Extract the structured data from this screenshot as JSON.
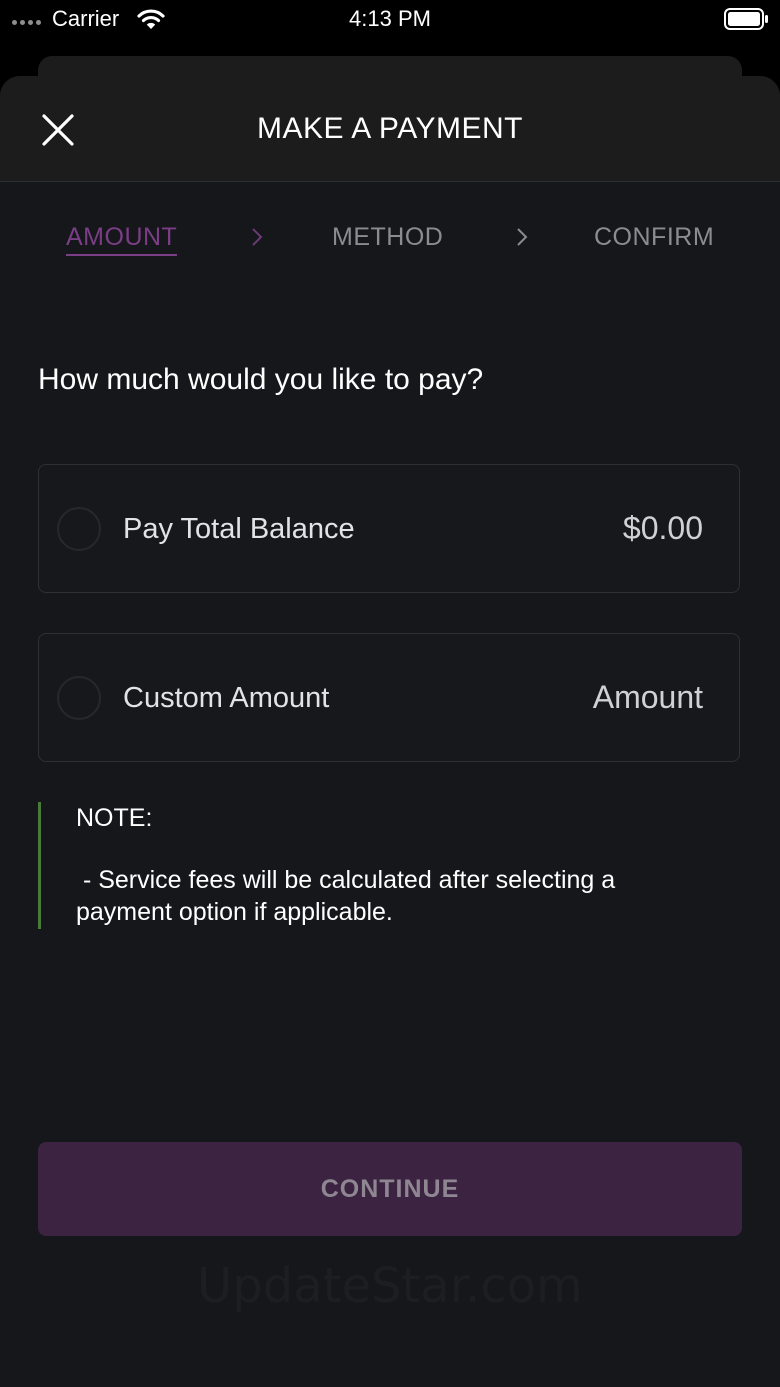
{
  "status_bar": {
    "carrier": "Carrier",
    "time": "4:13 PM"
  },
  "header": {
    "title": "MAKE A PAYMENT",
    "close_icon": "close-icon"
  },
  "steps": [
    {
      "label": "AMOUNT",
      "active": true
    },
    {
      "label": "METHOD",
      "active": false
    },
    {
      "label": "CONFIRM",
      "active": false
    }
  ],
  "question": "How much would you like to pay?",
  "options": [
    {
      "label": "Pay Total Balance",
      "value": "$0.00",
      "selected": false
    },
    {
      "label": "Custom Amount",
      "value": "Amount",
      "selected": false
    }
  ],
  "note": {
    "title": "NOTE:",
    "text": " - Service fees will be calculated after selecting a payment option if applicable."
  },
  "continue_label": "CONTINUE",
  "watermark": "UpdateStar.com",
  "colors": {
    "accent": "#7a3d86",
    "button_bg": "#3c2341",
    "note_bar": "#4a7a3a",
    "background": "#15171a"
  }
}
